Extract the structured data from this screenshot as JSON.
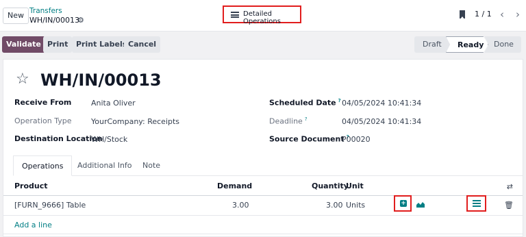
{
  "topbar": {
    "new_label": "New",
    "breadcrumb_parent": "Transfers",
    "breadcrumb_current": "WH/IN/00013",
    "detailed_ops_label": "Detailed Operations",
    "pager": "1 / 1"
  },
  "actions": {
    "validate": "Validate",
    "print": "Print",
    "print_labels": "Print Labels",
    "cancel": "Cancel"
  },
  "statusbar": {
    "stages": [
      "Draft",
      "Ready",
      "Done"
    ],
    "current": "Ready"
  },
  "record": {
    "title": "WH/IN/00013",
    "fields_left": [
      {
        "label": "Receive From",
        "value": "Anita Oliver"
      },
      {
        "label": "Operation Type",
        "value": "YourCompany: Receipts"
      },
      {
        "label": "Destination Location",
        "value": "WH/Stock"
      }
    ],
    "fields_right": [
      {
        "label": "Scheduled Date",
        "value": "04/05/2024 10:41:34"
      },
      {
        "label": "Deadline",
        "value": "04/05/2024 10:41:34"
      },
      {
        "label": "Source Document",
        "value": "P00020"
      }
    ],
    "help_marker": "?"
  },
  "tabs": [
    "Operations",
    "Additional Info",
    "Note"
  ],
  "table": {
    "headers": {
      "product": "Product",
      "demand": "Demand",
      "quantity": "Quantity",
      "unit": "Unit"
    },
    "rows": [
      {
        "product": "[FURN_9666] Table",
        "demand": "3.00",
        "quantity": "3.00",
        "unit": "Units"
      }
    ],
    "add_line": "Add a line"
  },
  "colors": {
    "brand": "#714b67",
    "accent": "#017e84",
    "highlight": "#e11d1d"
  }
}
